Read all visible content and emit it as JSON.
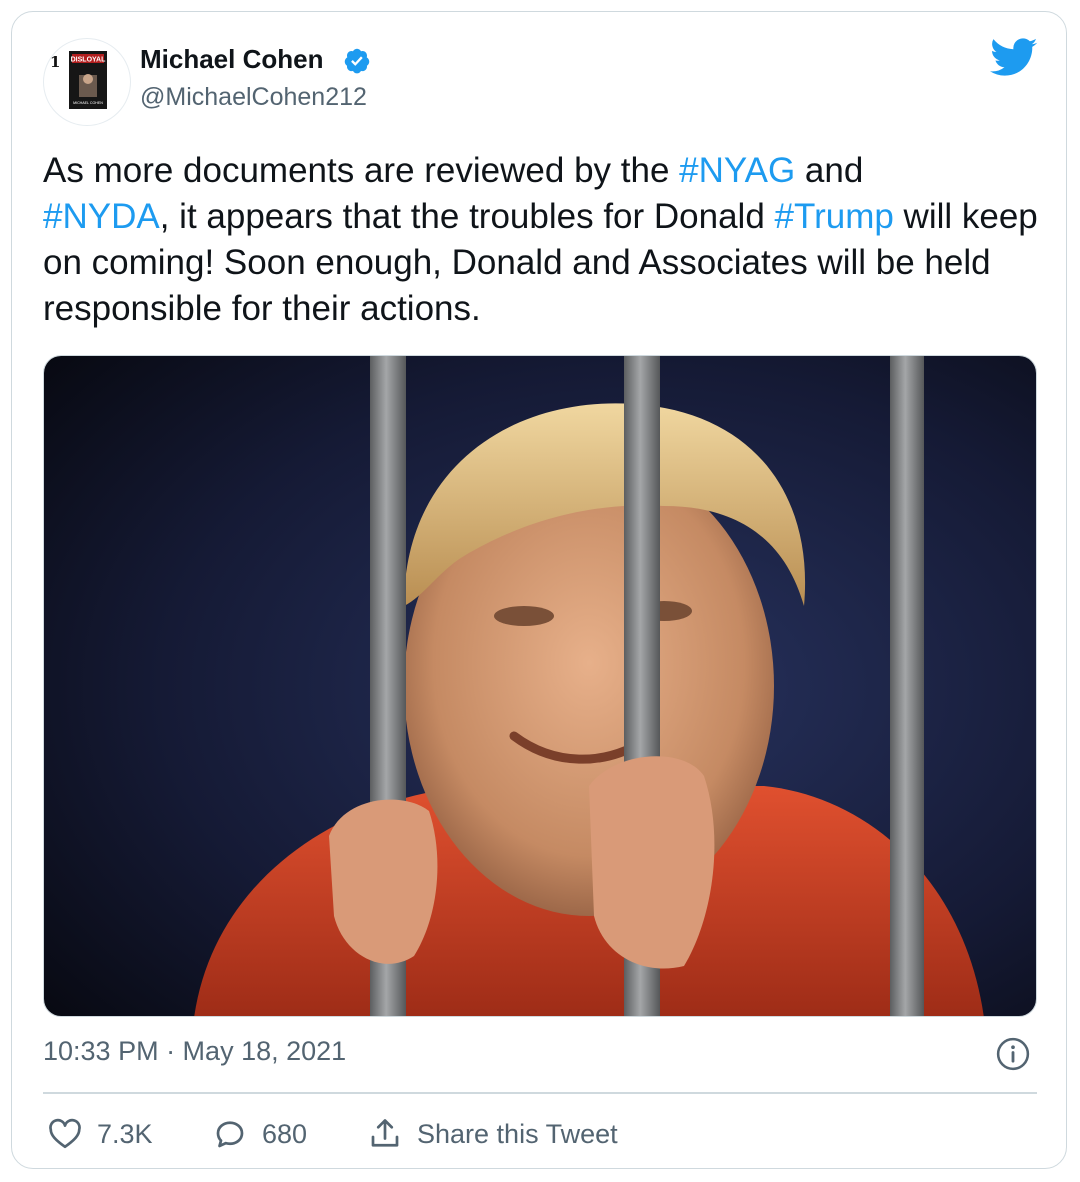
{
  "author": {
    "name": "Michael Cohen",
    "handle": "@MichaelCohen212",
    "avatar_rank": "1",
    "avatar_book_title": "DISLOYAL",
    "avatar_book_author": "MICHAEL COHEN"
  },
  "tweet": {
    "segments": [
      {
        "text": "As more documents are reviewed by the ",
        "tag": false
      },
      {
        "text": "#NYAG",
        "tag": true
      },
      {
        "text": " and ",
        "tag": false
      },
      {
        "text": "#NYDA",
        "tag": true
      },
      {
        "text": ", it appears that the troubles for Donald ",
        "tag": false
      },
      {
        "text": "#Trump",
        "tag": true
      },
      {
        "text": " will keep on coming! Soon enough, Donald and Associates will be held responsible for their actions.",
        "tag": false
      }
    ]
  },
  "timestamp": "10:33 PM · May 18, 2021",
  "actions": {
    "likes": "7.3K",
    "replies": "680",
    "share_label": "Share this Tweet"
  },
  "icons": {
    "logo": "twitter-bird-icon",
    "verified": "verified-badge-icon",
    "info": "info-icon",
    "like": "heart-icon",
    "reply": "reply-bubble-icon",
    "share": "share-upload-icon"
  },
  "colors": {
    "link": "#1d9bf0",
    "text": "#0f1419",
    "secondary": "#536471",
    "border": "#cfd9de"
  }
}
